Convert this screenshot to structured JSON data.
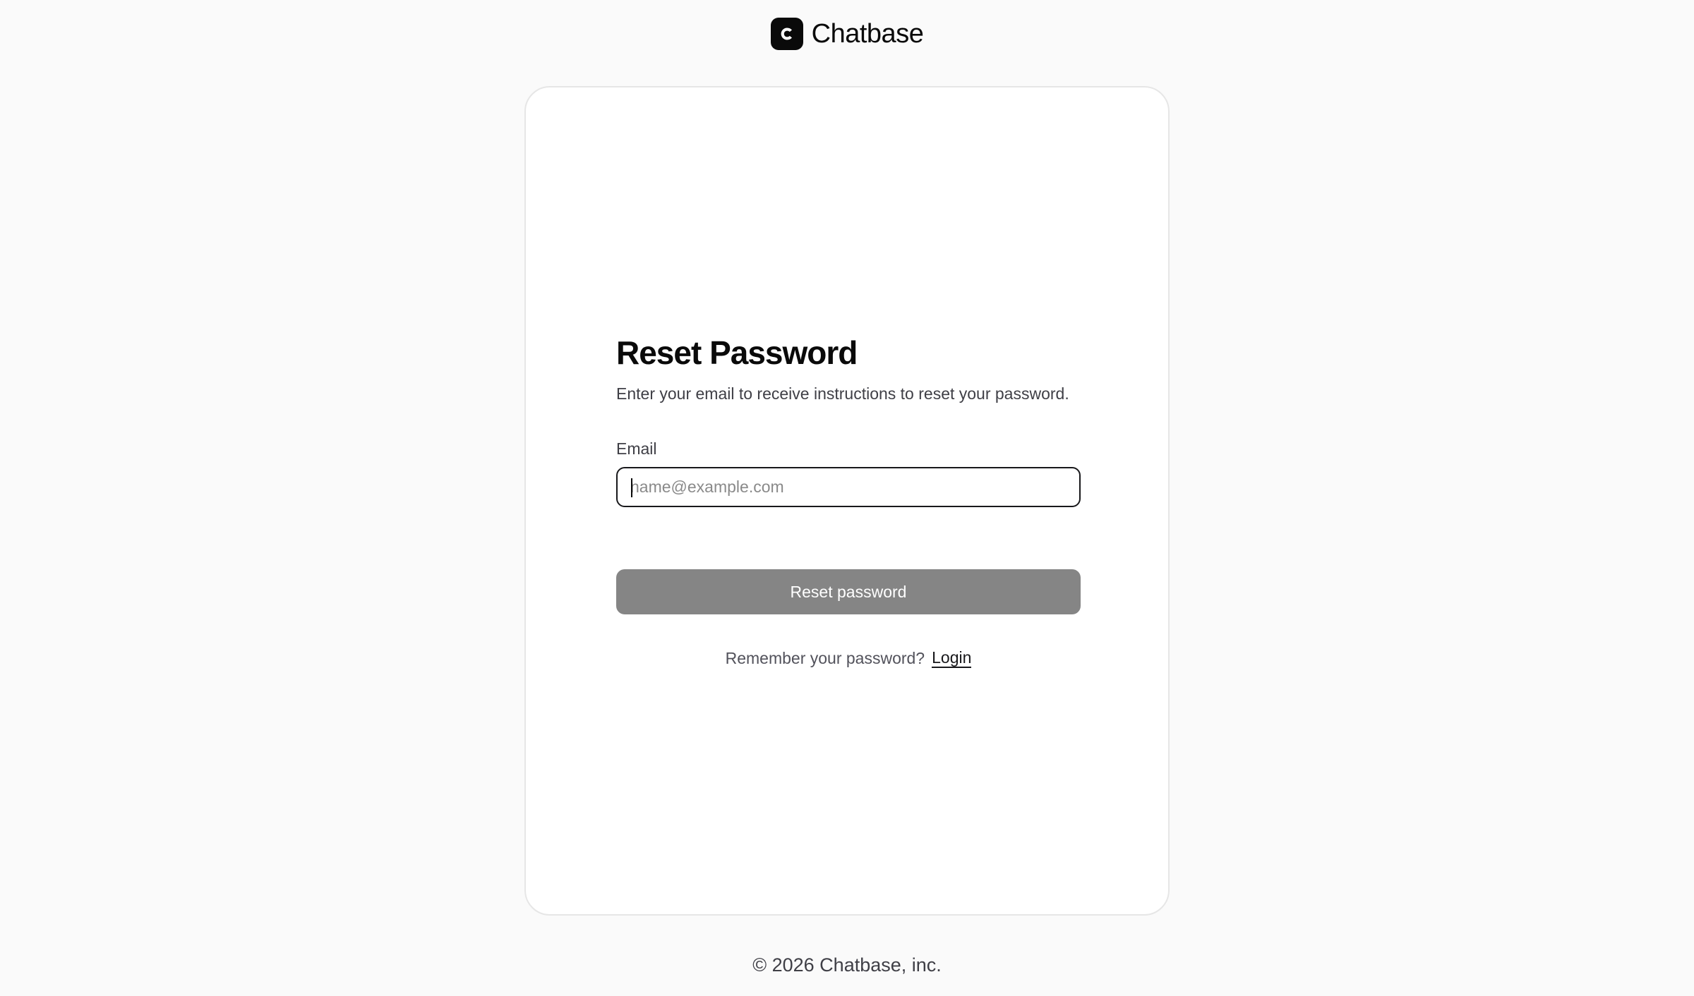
{
  "brand": {
    "name": "Chatbase",
    "logo_icon": "chatbase-c-logo-icon"
  },
  "form": {
    "title": "Reset Password",
    "subtitle": "Enter your email to receive instructions to reset your password.",
    "email_label": "Email",
    "email_value": "",
    "email_placeholder": "name@example.com",
    "submit_label": "Reset password",
    "remember_text": "Remember your password?",
    "login_label": "Login"
  },
  "footer": {
    "copyright": "© 2026 Chatbase, inc."
  },
  "colors": {
    "background": "#fafafa",
    "card": "#ffffff",
    "button_disabled": "#858585",
    "text_primary": "#0a0a0a"
  }
}
